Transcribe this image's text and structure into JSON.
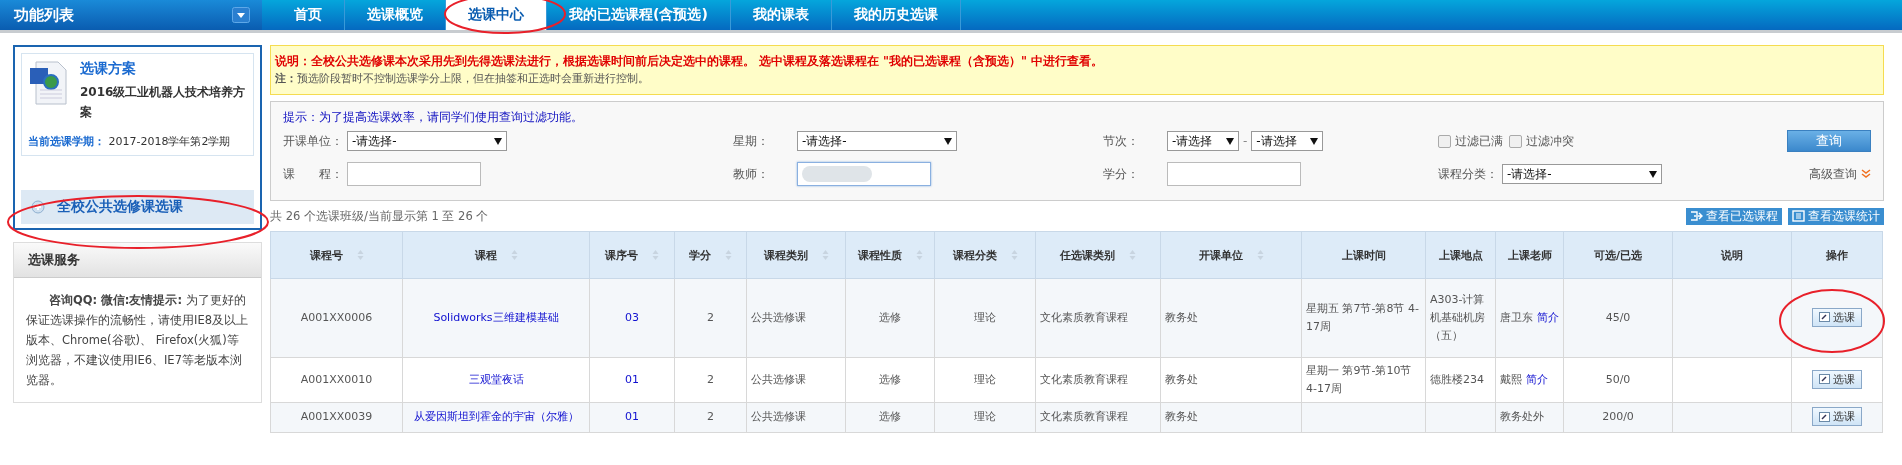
{
  "sidebar": {
    "title": "功能列表",
    "plan": {
      "heading": "选课方案",
      "name": "2016级工业机器人技术培养方案",
      "term_label": "当前选课学期：",
      "term_value": "2017-2018学年第2学期"
    },
    "menu_items": [
      {
        "label": "全校公共选修课选课",
        "selected": true
      }
    ],
    "service": {
      "title": "选课服务",
      "text": "**咨询QQ:**          **微信:友情提示:** 为了更好的保证选课操作的流畅性，请使用IE8及以上版本、Chrome(谷歌)、 Firefox(火狐)等浏览器，不建议使用IE6、IE7等老版本浏览器。"
    }
  },
  "tabs": [
    {
      "label": "首页",
      "selected": false
    },
    {
      "label": "选课概览",
      "selected": false
    },
    {
      "label": "选课中心",
      "selected": true
    },
    {
      "label": "我的已选课程(含预选)",
      "selected": false
    },
    {
      "label": "我的课表",
      "selected": false
    },
    {
      "label": "我的历史选课",
      "selected": false
    }
  ],
  "notice": {
    "lead": "**说明：全校公共选修课本次采用先到先得选课法进行，根据选课时间前后决定选中的课程。 选中课程及落选课程在 \"我的已选课程（含预选）\" 中进行查看。**",
    "note": "**注：**预选阶段暂时不控制选课学分上限，但在抽签和正选时会重新进行控制。"
  },
  "filters": {
    "hint": "提示：为了提高选课效率，请同学们使用查询过滤功能。",
    "row_1": [
      {
        "kind": "select",
        "label": "开课单位：",
        "value": "-请选择-"
      },
      {
        "kind": "select",
        "label": "星期：",
        "value": "-请选择-"
      },
      {
        "kind": "range",
        "label": "节次：",
        "from": "-请选择",
        "separator": "-",
        "to": "-请选择"
      },
      {
        "kind": "checks",
        "options": [
          {
            "label": "过滤已满",
            "checked": false
          },
          {
            "label": "过滤冲突",
            "checked": false
          }
        ]
      }
    ],
    "row_2": [
      {
        "kind": "text",
        "label": "课　　程：",
        "blurred": false
      },
      {
        "kind": "text",
        "label": "教师：",
        "blurred": true
      },
      {
        "kind": "text",
        "label": "学分：",
        "blurred": false
      },
      {
        "kind": "select",
        "label": "课程分类：",
        "value": "-请选择-"
      }
    ],
    "query_button": "查询",
    "advanced_link": "高级查询"
  },
  "summary": "共 26 个选课班级/当前显示第 1 至 26 个",
  "actions": [
    "查看已选课程",
    "查看选课统计"
  ],
  "table": {
    "columns": [
      {
        "label": "课程号",
        "sortable": true
      },
      {
        "label": "课程",
        "sortable": true
      },
      {
        "label": "课序号",
        "sortable": true
      },
      {
        "label": "学分",
        "sortable": true
      },
      {
        "label": "课程类别",
        "sortable": true
      },
      {
        "label": "课程性质",
        "sortable": true
      },
      {
        "label": "课程分类",
        "sortable": true
      },
      {
        "label": "任选课类别",
        "sortable": true
      },
      {
        "label": "开课单位",
        "sortable": true
      },
      {
        "label": "上课时间",
        "sortable": false
      },
      {
        "label": "上课地点",
        "sortable": false
      },
      {
        "label": "上课老师",
        "sortable": false
      },
      {
        "label": "可选/已选",
        "sortable": false
      },
      {
        "label": "说明",
        "sortable": false
      },
      {
        "label": "操作",
        "sortable": false
      }
    ],
    "rows": [
      {
        "cells": [
          {
            "kind": "text",
            "text": "A001XX0006"
          },
          {
            "kind": "link",
            "text": "Solidworks三维建模基础"
          },
          {
            "kind": "link",
            "text": "03"
          },
          {
            "kind": "text",
            "text": "2"
          },
          {
            "kind": "left",
            "text": "公共选修课"
          },
          {
            "kind": "text",
            "text": "选修"
          },
          {
            "kind": "text",
            "text": "理论"
          },
          {
            "kind": "left",
            "text": "文化素质教育课程"
          },
          {
            "kind": "left",
            "text": "教务处"
          },
          {
            "kind": "left",
            "text": "星期五 第7节-第8节 4-17周"
          },
          {
            "kind": "left",
            "text": "A303-计算机基础机房（五）"
          },
          {
            "kind": "teacher",
            "name": "唐卫东",
            "link": "简介"
          },
          {
            "kind": "text",
            "text": "45/0"
          },
          {
            "kind": "blank"
          },
          {
            "kind": "button",
            "text": "选课"
          }
        ]
      },
      {
        "cells": [
          {
            "kind": "text",
            "text": "A001XX0010"
          },
          {
            "kind": "link",
            "text": "三观堂夜话"
          },
          {
            "kind": "link",
            "text": "01"
          },
          {
            "kind": "text",
            "text": "2"
          },
          {
            "kind": "left",
            "text": "公共选修课"
          },
          {
            "kind": "text",
            "text": "选修"
          },
          {
            "kind": "text",
            "text": "理论"
          },
          {
            "kind": "left",
            "text": "文化素质教育课程"
          },
          {
            "kind": "left",
            "text": "教务处"
          },
          {
            "kind": "left",
            "text": "星期一 第9节-第10节 4-17周"
          },
          {
            "kind": "left",
            "text": "德胜楼234"
          },
          {
            "kind": "teacher",
            "name": "戴熙",
            "link": "简介"
          },
          {
            "kind": "text",
            "text": "50/0"
          },
          {
            "kind": "blank"
          },
          {
            "kind": "button",
            "text": "选课"
          }
        ]
      },
      {
        "cells": [
          {
            "kind": "text",
            "text": "A001XX0039"
          },
          {
            "kind": "link",
            "text": "从爱因斯坦到霍金的宇宙（尔雅）"
          },
          {
            "kind": "link",
            "text": "01"
          },
          {
            "kind": "text",
            "text": "2"
          },
          {
            "kind": "left",
            "text": "公共选修课"
          },
          {
            "kind": "text",
            "text": "选修"
          },
          {
            "kind": "text",
            "text": "理论"
          },
          {
            "kind": "left",
            "text": "文化素质教育课程"
          },
          {
            "kind": "left",
            "text": "教务处"
          },
          {
            "kind": "blank"
          },
          {
            "kind": "blank"
          },
          {
            "kind": "left",
            "text": "教务处外"
          },
          {
            "kind": "text",
            "text": "200/0"
          },
          {
            "kind": "blank"
          },
          {
            "kind": "button",
            "text": "选课"
          }
        ]
      }
    ]
  }
}
